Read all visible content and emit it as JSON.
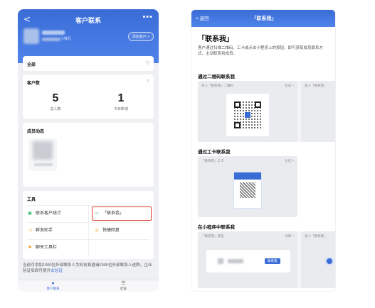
{
  "left": {
    "nav": {
      "back": "<",
      "title": "客户联系",
      "more": "•••"
    },
    "user": {
      "subtitle": "小锋孔"
    },
    "add_customer": "添加客户 >",
    "filter": {
      "label": "全部",
      "icon": "▽"
    },
    "count_card": {
      "title": "客户数",
      "chevron": ">",
      "stats": [
        {
          "value": "5",
          "label": "总人数"
        },
        {
          "value": "1",
          "label": "今日新增"
        }
      ]
    },
    "member_card": {
      "title": "成员动态"
    },
    "tools": {
      "title": "工具",
      "items": [
        {
          "icon": "▣",
          "label": "联系客户统计",
          "color": "#2dbb6b"
        },
        {
          "icon": "▭",
          "label": "「联系我」",
          "color": "#2dbb6b"
        },
        {
          "icon": "◁",
          "label": "群发助手",
          "color": "#f0a020"
        },
        {
          "icon": "◎",
          "label": "快捷回复",
          "color": "#f0a020"
        },
        {
          "icon": "✱",
          "label": "聊天工具栏",
          "color": "#f0a020"
        }
      ]
    },
    "notice": {
      "text": "当前可添加1000位外部联系人为好友和邀请2000位外部联系人进群。企业验证后即可提升",
      "link": "去验证"
    },
    "tabbar": [
      {
        "icon": "●",
        "label": "客户联系"
      },
      {
        "icon": "☰",
        "label": "配置"
      }
    ]
  },
  "right": {
    "nav": {
      "back": "< 返回",
      "title": "「联系我」"
    },
    "heading": "「联系我」",
    "description": "客户通过扫描二维码、工卡或点击小程序上的按钮，即可获取成员联系方式，主动联系到成员。",
    "sections": {
      "qr": {
        "title": "通过二维码联系我",
        "card_title": "单人「联系我」二维码",
        "card_action": "生成 >",
        "card2_title": "多人「联系我」"
      },
      "workcard": {
        "title": "通过工卡联系我",
        "card_title": "「联系我」工卡",
        "card_action": "生成 >"
      },
      "miniprogram": {
        "title": "在小程序中联系我",
        "card_title": "「联系我」按钮",
        "card_action": "详细 >",
        "card2_title": "多人「联系我」",
        "button_label": "联系我"
      }
    }
  }
}
